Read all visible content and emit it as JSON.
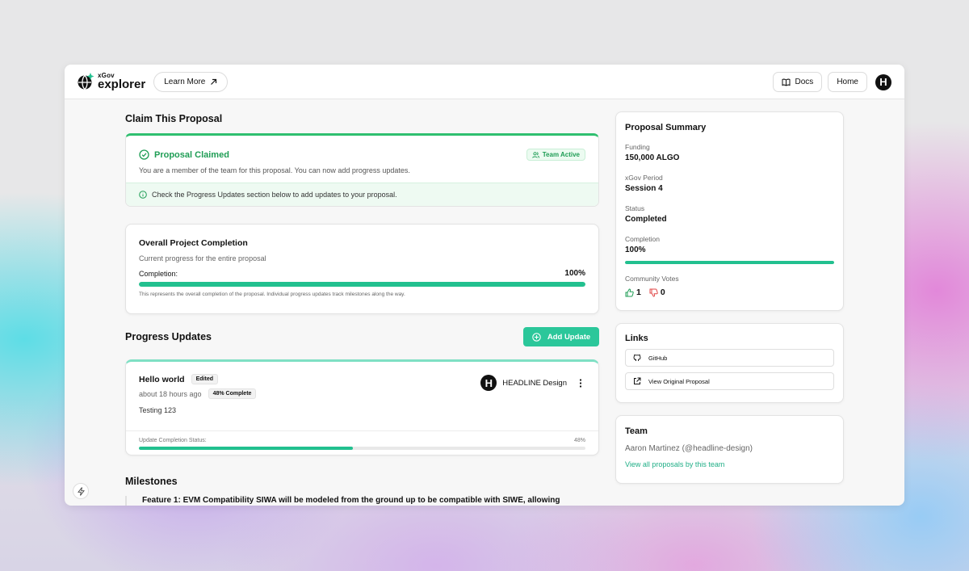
{
  "header": {
    "logo_small": "xGov",
    "logo_large": "explorer",
    "learn_more": "Learn More",
    "docs": "Docs",
    "home": "Home",
    "avatar_letter": "H"
  },
  "claim": {
    "section_title": "Claim This Proposal",
    "status_title": "Proposal Claimed",
    "badge": "Team Active",
    "description": "You are a member of the team for this proposal. You can now add progress updates.",
    "info": "Check the Progress Updates section below to add updates to your proposal."
  },
  "completion": {
    "title": "Overall Project Completion",
    "subtitle": "Current progress for the entire proposal",
    "label": "Completion:",
    "percent_text": "100%",
    "progress": 1.0,
    "note": "This represents the overall completion of the proposal. Individual progress updates track milestones along the way."
  },
  "progress_updates": {
    "section_title": "Progress Updates",
    "add_button": "Add Update",
    "items": [
      {
        "title": "Hello world",
        "edited_chip": "Edited",
        "time": "about 18 hours ago",
        "complete_chip": "48% Complete",
        "body": "Testing 123",
        "author_letter": "H",
        "author": "HEADLINE Design",
        "status_label": "Update Completion Status:",
        "status_percent": "48%",
        "progress": 0.48
      }
    ]
  },
  "milestones": {
    "section_title": "Milestones",
    "items": [
      "Feature 1: EVM Compatibility SIWA will be modeled from the ground up to be compatible with SIWE, allowing"
    ]
  },
  "summary": {
    "title": "Proposal Summary",
    "funding_label": "Funding",
    "funding_value": "150,000 ALGO",
    "period_label": "xGov Period",
    "period_value": "Session 4",
    "status_label": "Status",
    "status_value": "Completed",
    "completion_label": "Completion",
    "completion_value": "100%",
    "completion_progress": 1.0,
    "votes_label": "Community Votes",
    "votes_up": "1",
    "votes_down": "0"
  },
  "links": {
    "title": "Links",
    "github": "GitHub",
    "original": "View Original Proposal"
  },
  "team": {
    "title": "Team",
    "member": "Aaron Martinez (@headline-design)",
    "view_all": "View all proposals by this team"
  },
  "colors": {
    "accent": "#22c08f",
    "claimed_green": "#1f9d55",
    "vote_up": "#1f9d55",
    "vote_down": "#e04646"
  }
}
